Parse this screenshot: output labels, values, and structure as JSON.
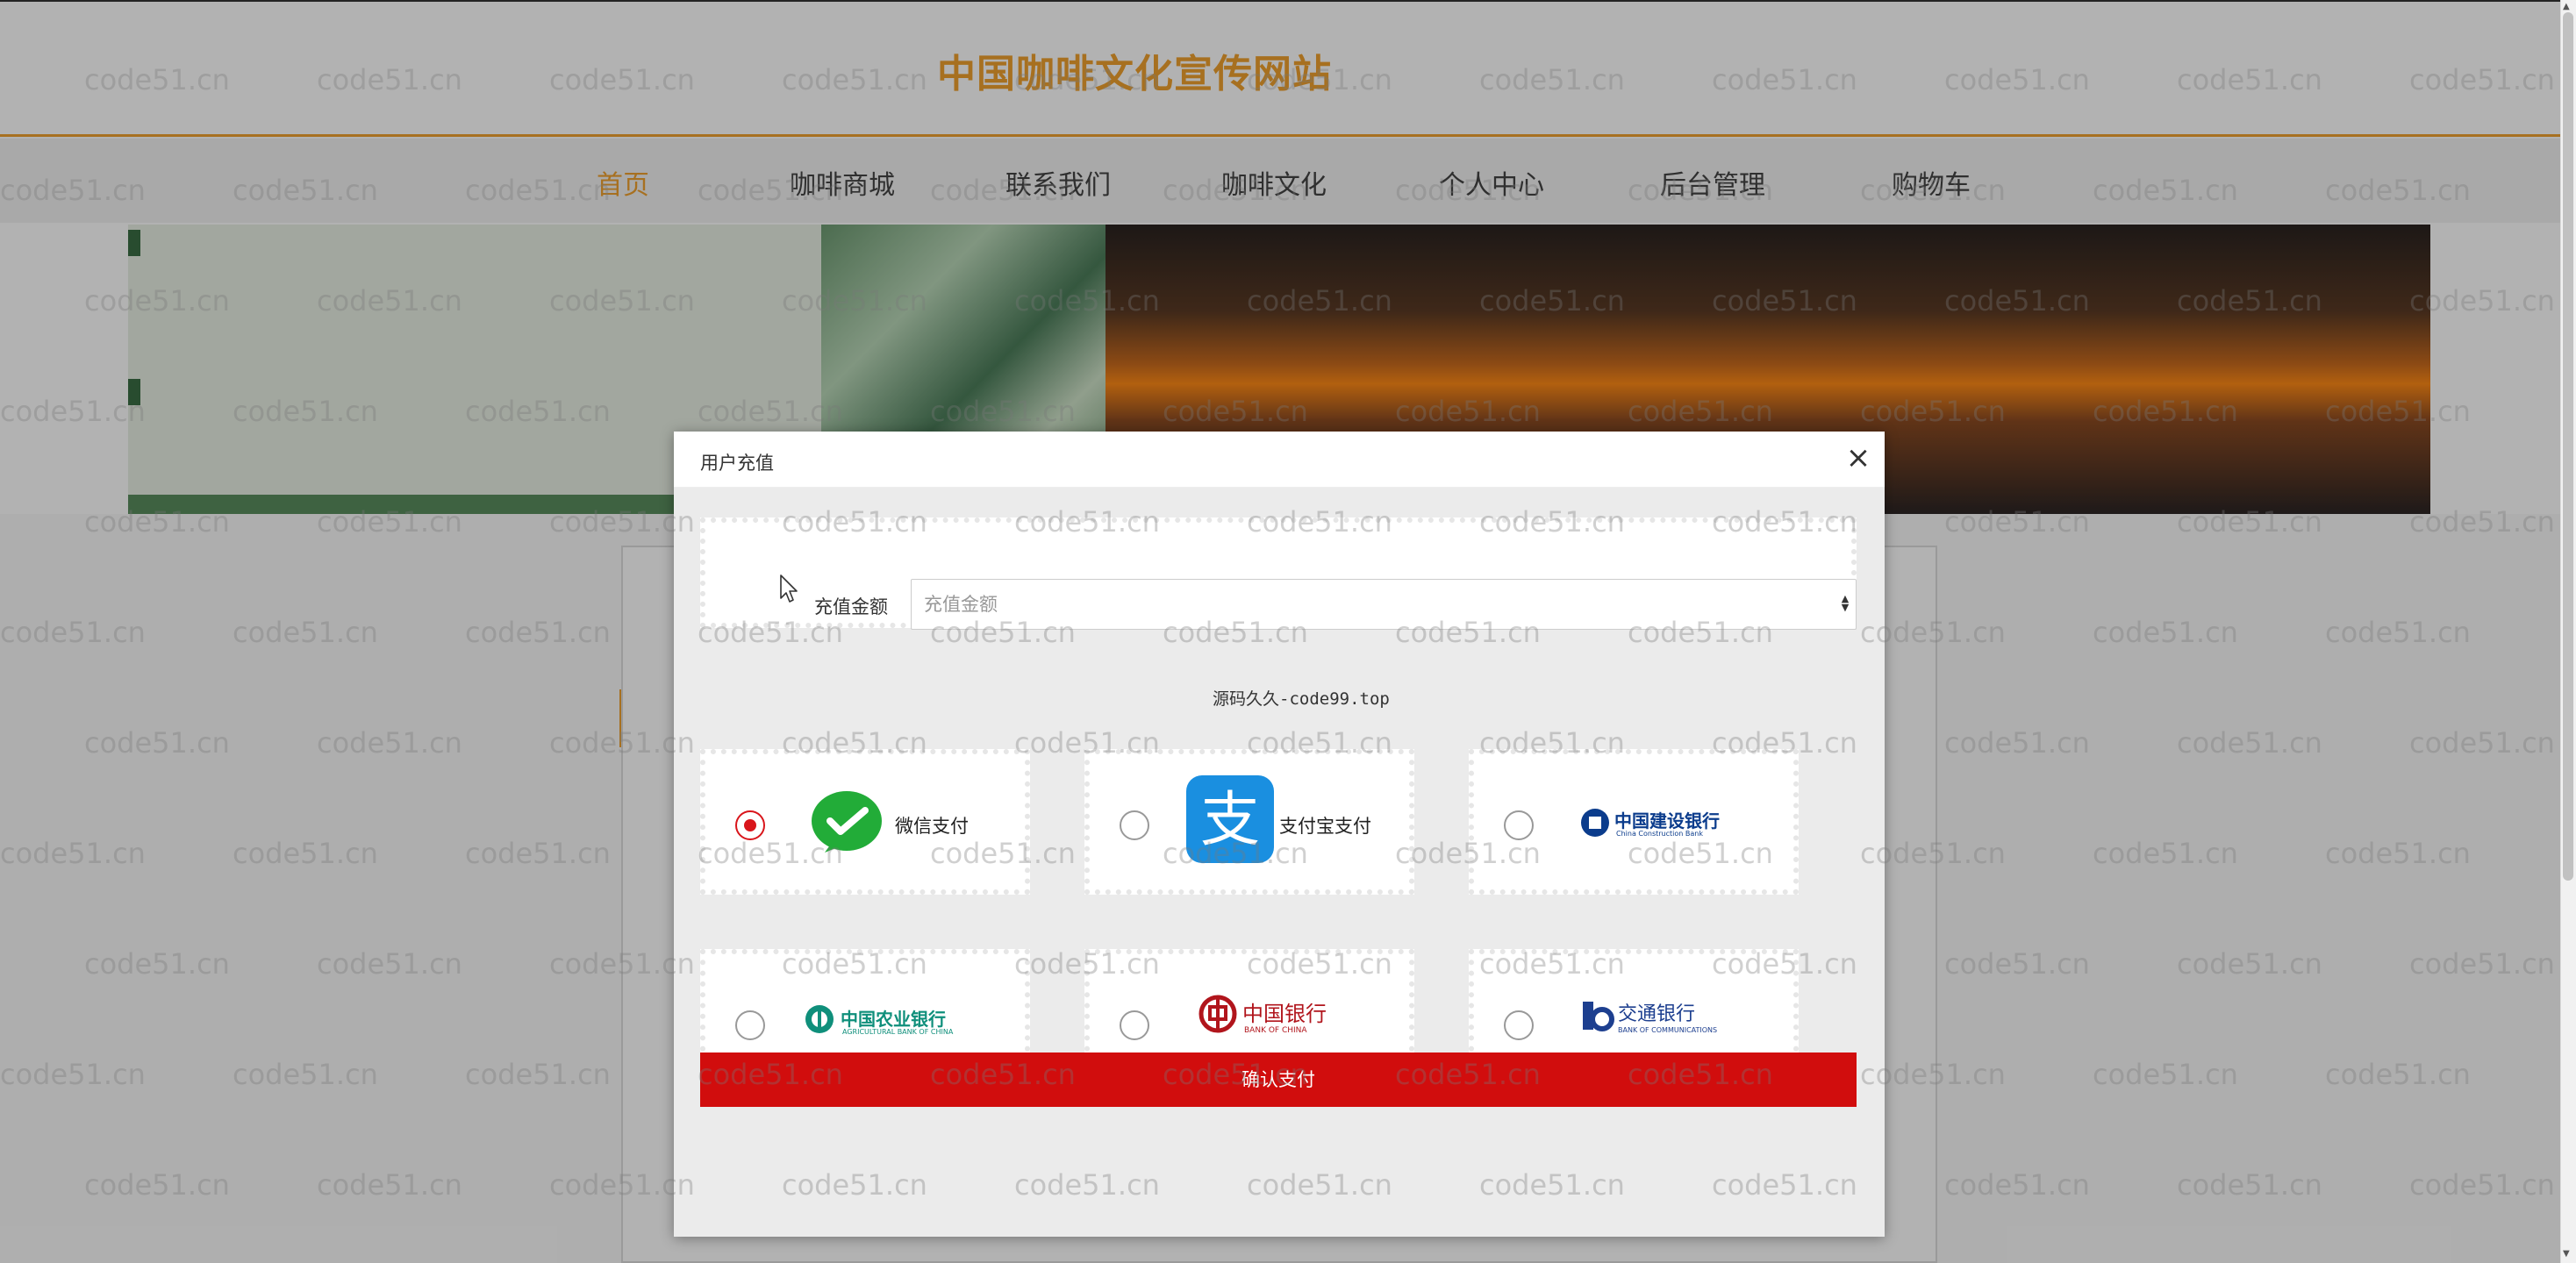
{
  "site": {
    "title": "中国咖啡文化宣传网站",
    "accent_color": "#f0a12e"
  },
  "nav": {
    "items": [
      {
        "label": "首页",
        "active": true
      },
      {
        "label": "咖啡商城",
        "active": false
      },
      {
        "label": "联系我们",
        "active": false
      },
      {
        "label": "咖啡文化",
        "active": false
      },
      {
        "label": "个人中心",
        "active": false
      },
      {
        "label": "后台管理",
        "active": false
      },
      {
        "label": "购物车",
        "active": false
      }
    ]
  },
  "watermark": "code51.cn",
  "modal": {
    "title": "用户充值",
    "close_icon": "×",
    "amount_label": "充值金额",
    "amount_placeholder": "充值金额",
    "promo_text": "源码久久-code99.top",
    "payment_methods": [
      {
        "id": "wechat",
        "label": "微信支付",
        "icon": "wechat-pay-icon",
        "selected": true
      },
      {
        "id": "alipay",
        "label": "支付宝支付",
        "icon": "alipay-icon",
        "selected": false
      },
      {
        "id": "ccb",
        "label": "中国建设银行",
        "sublabel": "China Construction Bank",
        "icon": "ccb-logo-icon",
        "selected": false
      },
      {
        "id": "abc",
        "label": "中国农业银行",
        "sublabel": "AGRICULTURAL BANK OF CHINA",
        "icon": "abc-logo-icon",
        "selected": false
      },
      {
        "id": "boc",
        "label": "中国银行",
        "sublabel": "BANK OF CHINA",
        "icon": "boc-logo-icon",
        "selected": false
      },
      {
        "id": "bocom",
        "label": "交通银行",
        "sublabel": "BANK OF COMMUNICATIONS",
        "icon": "bocom-logo-icon",
        "selected": false
      }
    ],
    "submit_label": "确认支付",
    "submit_color": "#d10d0d"
  }
}
